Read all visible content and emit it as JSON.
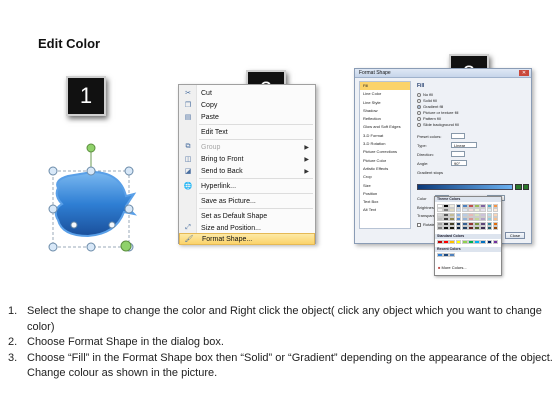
{
  "page_title": "Edit Color",
  "badges": [
    "1",
    "2",
    "3"
  ],
  "colors": {
    "shape_fill": "#2f7fd4",
    "handle_green": "#8fd16a",
    "handle_blue": "#d8e8f8",
    "menu_highlight": "#fbd36a"
  },
  "context_menu": {
    "items": [
      {
        "icon": "scissors-icon",
        "label": "Cut",
        "underline": "t",
        "submenu": false,
        "disabled": false
      },
      {
        "icon": "copy-icon",
        "label": "Copy",
        "submenu": false,
        "disabled": false
      },
      {
        "icon": "paste-icon",
        "label": "Paste",
        "submenu": false,
        "disabled": false
      },
      {
        "icon": "edit-text-icon",
        "label": "Edit Text",
        "submenu": false,
        "disabled": false
      },
      {
        "icon": "group-icon",
        "label": "Group",
        "submenu": true,
        "disabled": true
      },
      {
        "icon": "bring-to-front-icon",
        "label": "Bring to Front",
        "submenu": true,
        "disabled": false
      },
      {
        "icon": "send-to-back-icon",
        "label": "Send to Back",
        "submenu": true,
        "disabled": false
      },
      {
        "icon": "hyperlink-icon",
        "label": "Hyperlink...",
        "submenu": false,
        "disabled": false
      },
      {
        "icon": "",
        "label": "Save as Picture...",
        "submenu": false,
        "disabled": false
      },
      {
        "icon": "",
        "label": "Set as Default Shape",
        "submenu": false,
        "disabled": false
      },
      {
        "icon": "size-position-icon",
        "label": "Size and Position...",
        "submenu": false,
        "disabled": false
      },
      {
        "icon": "format-shape-icon",
        "label": "Format Shape...",
        "submenu": false,
        "disabled": false,
        "highlighted": true
      }
    ]
  },
  "format_dialog": {
    "title": "Format Shape",
    "nav": [
      "Fill",
      "Line Color",
      "Line Style",
      "Shadow",
      "Reflection",
      "Glow and Soft Edges",
      "3-D Format",
      "3-D Rotation",
      "Picture Corrections",
      "Picture Color",
      "Artistic Effects",
      "Crop",
      "Size",
      "Position",
      "Text Box",
      "Alt Text"
    ],
    "pane_heading": "Fill",
    "fill_options": [
      "No fill",
      "Solid fill",
      "Gradient fill",
      "Picture or texture fill",
      "Pattern fill",
      "Slide background fill"
    ],
    "labels": {
      "preset": "Preset colors:",
      "type": "Type:",
      "type_value": "Linear",
      "direction": "Direction:",
      "angle": "Angle:",
      "angle_value": "90°",
      "stops": "Gradient stops",
      "color": "Color",
      "position": "Position:",
      "position_value": "100%",
      "brightness": "Brightness:",
      "transparency": "Transparency:",
      "rotate": "Rotate with shape",
      "close": "Close"
    },
    "picker": {
      "theme": "Theme Colors",
      "standard": "Standard Colors",
      "recent": "Recent Colors",
      "more": "More Colors..."
    }
  },
  "instructions": [
    {
      "num": "1.",
      "text": "Select the shape to change the color and Right click the object( click any object which you want to change color)"
    },
    {
      "num": "2.",
      "text": "Choose Format Shape in the dialog box."
    },
    {
      "num": "3.",
      "text": "Choose “Fill” in the Format Shape box then “Solid” or “Gradient” depending on the appearance of the object. Change colour as shown in the picture."
    }
  ]
}
